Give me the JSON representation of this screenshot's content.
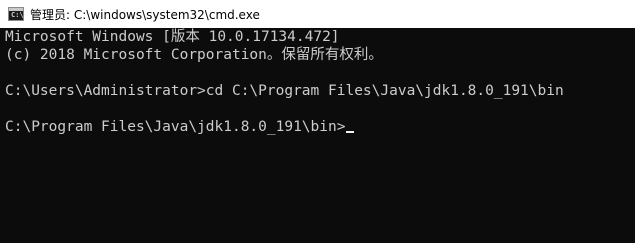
{
  "window": {
    "title": "管理员: C:\\windows\\system32\\cmd.exe",
    "icon_name": "cmd-icon",
    "icon_glyph": "C:\\"
  },
  "console": {
    "lines": [
      "Microsoft Windows [版本 10.0.17134.472]",
      "(c) 2018 Microsoft Corporation。保留所有权利。",
      "",
      "C:\\Users\\Administrator>cd C:\\Program Files\\Java\\jdk1.8.0_191\\bin",
      "",
      "C:\\Program Files\\Java\\jdk1.8.0_191\\bin>"
    ]
  },
  "colors": {
    "background": "#0c0c0c",
    "foreground": "#cccccc",
    "titlebar": "#ffffff"
  }
}
